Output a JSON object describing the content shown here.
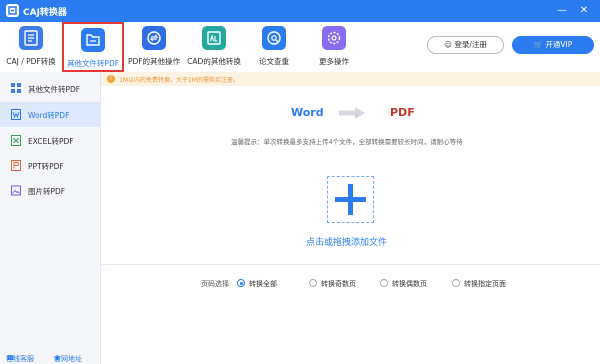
{
  "app": {
    "title": "CAJ转换器"
  },
  "window": {
    "minimize": "—",
    "close": "✕"
  },
  "toolbar": {
    "tools": [
      {
        "label": "CAJ / PDF转换",
        "icon": "caj-pdf-convert-icon"
      },
      {
        "label": "其他文件转PDF",
        "icon": "file-to-pdf-icon",
        "active": true
      },
      {
        "label": "PDF的其他操作",
        "icon": "pdf-operations-icon"
      },
      {
        "label": "CAD的其他转换",
        "icon": "cad-convert-icon"
      },
      {
        "label": "论文查重",
        "icon": "plagiarism-check-icon"
      },
      {
        "label": "更多操作",
        "icon": "gear-icon"
      }
    ],
    "login_label": "登录/注册",
    "vip_label": "开通VIP"
  },
  "sidebar": {
    "items": [
      {
        "label": "其他文件转PDF",
        "icon": "grid-icon"
      },
      {
        "label": "Word转PDF",
        "icon": "word-icon",
        "active": true
      },
      {
        "label": "EXCEL转PDF",
        "icon": "excel-icon"
      },
      {
        "label": "PPT转PDF",
        "icon": "ppt-icon"
      },
      {
        "label": "图片转PDF",
        "icon": "image-icon"
      }
    ],
    "footer": {
      "service": "在线客服",
      "website": "官网地址"
    }
  },
  "notice": {
    "text": "1M以内的免费转换，大于1M的需购买注册。"
  },
  "main": {
    "conversion": {
      "from": "Word",
      "to": "PDF"
    },
    "tip": "温馨提示：单次转换最多支持上传4个文件，全部转换需要较长时间，请耐心等待",
    "drop_label": "点击或拖拽添加文件",
    "pages": {
      "label": "页码选择",
      "options": [
        {
          "label": "转换全部",
          "checked": true
        },
        {
          "label": "转换奇数页",
          "checked": false
        },
        {
          "label": "转换偶数页",
          "checked": false
        },
        {
          "label": "转换指定页面",
          "checked": false
        }
      ]
    }
  },
  "colors": {
    "accent": "#2b7cf0",
    "highlight_border": "#e53935",
    "target_format": "#c0392b",
    "notice_text": "#e8963a"
  }
}
